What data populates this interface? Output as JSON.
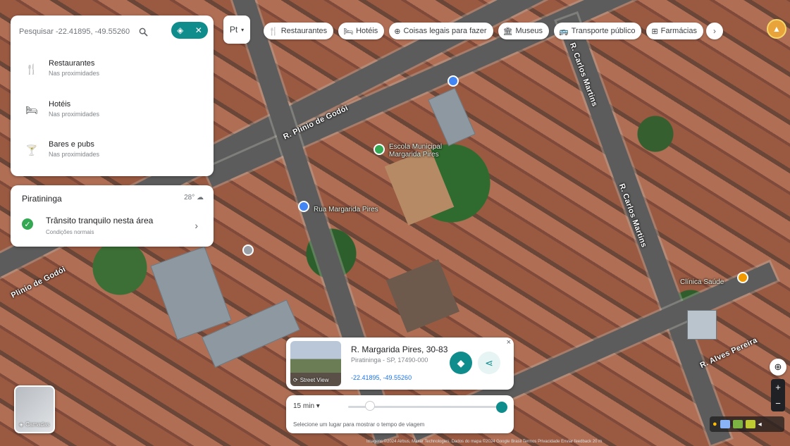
{
  "search": {
    "placeholder": "Pesquisar -22.41895, -49.55260",
    "search_icon": "search-icon",
    "pill_icons": [
      "directions-icon",
      "close-icon"
    ]
  },
  "categories": [
    {
      "icon": "restaurant-icon",
      "title": "Restaurantes",
      "subtitle": "Nas proximidades"
    },
    {
      "icon": "hotel-icon",
      "title": "Hotéis",
      "subtitle": "Nas proximidades"
    },
    {
      "icon": "bar-icon",
      "title": "Bares e pubs",
      "subtitle": "Nas proximidades"
    }
  ],
  "traffic": {
    "city": "Piratininga",
    "temperature": "28°",
    "status": "Trânsito tranquilo nesta área",
    "status_sub": "Condições normais"
  },
  "top_chips": {
    "language": "Pt",
    "items": [
      {
        "icon": "restaurant-icon",
        "label": "Restaurantes"
      },
      {
        "icon": "hotel-icon",
        "label": "Hotéis"
      },
      {
        "icon": "things-to-do-icon",
        "label": "Coisas legais para fazer"
      },
      {
        "icon": "museum-icon",
        "label": "Museus"
      },
      {
        "icon": "transit-icon",
        "label": "Transporte público"
      },
      {
        "icon": "pharmacy-icon",
        "label": "Farmácias"
      }
    ]
  },
  "map": {
    "roads": [
      "R. Plinio de Godói",
      "Plinio de Godói",
      "R. Carlos Martins",
      "R. Carlos Martins",
      "R. Alves Pereira"
    ],
    "pois": [
      "Escola Municipal Margarida Pires",
      "Rua Margarida Pires",
      "Clínica Saúde"
    ]
  },
  "place_card": {
    "title": "R. Margarida Pires, 30-83",
    "subtitle": "Piratininga - SP, 17490-000",
    "coords": "-22.41895, -49.55260",
    "thumb_label": "Street View"
  },
  "time": {
    "mode": "15 min",
    "hint": "Selecione um lugar para mostrar o tempo de viagem"
  },
  "layers": {
    "label": "Camadas"
  },
  "attribution": "Imagens ©2024 Airbus, Maxar Technologies, Dados do mapa ©2024 Google  Brasil  Termos  Privacidade  Enviar feedback  20 m",
  "colors": {
    "accent": "#0f8c8c",
    "traffic_ok": "#34a853",
    "link": "#1a73e8"
  }
}
